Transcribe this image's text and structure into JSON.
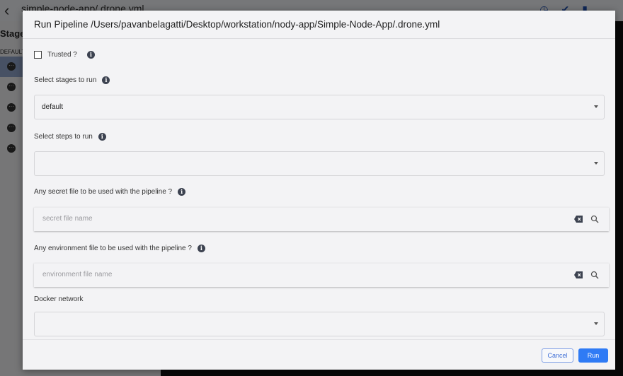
{
  "background": {
    "title": "simple-node-app/.drone.yml",
    "stages_heading": "Stages",
    "group_label": "DEFAULT",
    "stage_row_count": 5
  },
  "modal": {
    "title": "Run Pipeline /Users/pavanbelagatti/Desktop/workstation/nody-app/Simple-Node-App/.drone.yml",
    "trusted": {
      "label": "Trusted ?",
      "checked": false
    },
    "stages": {
      "label": "Select stages to run",
      "value": "default"
    },
    "steps": {
      "label": "Select steps to run",
      "value": ""
    },
    "secret_file": {
      "label": "Any secret file to be used with the pipeline ?",
      "placeholder": "secret file name",
      "value": ""
    },
    "env_file": {
      "label": "Any environment file to be used with the pipeline ?",
      "placeholder": "environment file name",
      "value": ""
    },
    "docker_network": {
      "label": "Docker network",
      "value": ""
    },
    "buttons": {
      "cancel": "Cancel",
      "run": "Run"
    }
  },
  "colors": {
    "primary": "#2f7bf5",
    "info_icon": "#3c4250"
  }
}
